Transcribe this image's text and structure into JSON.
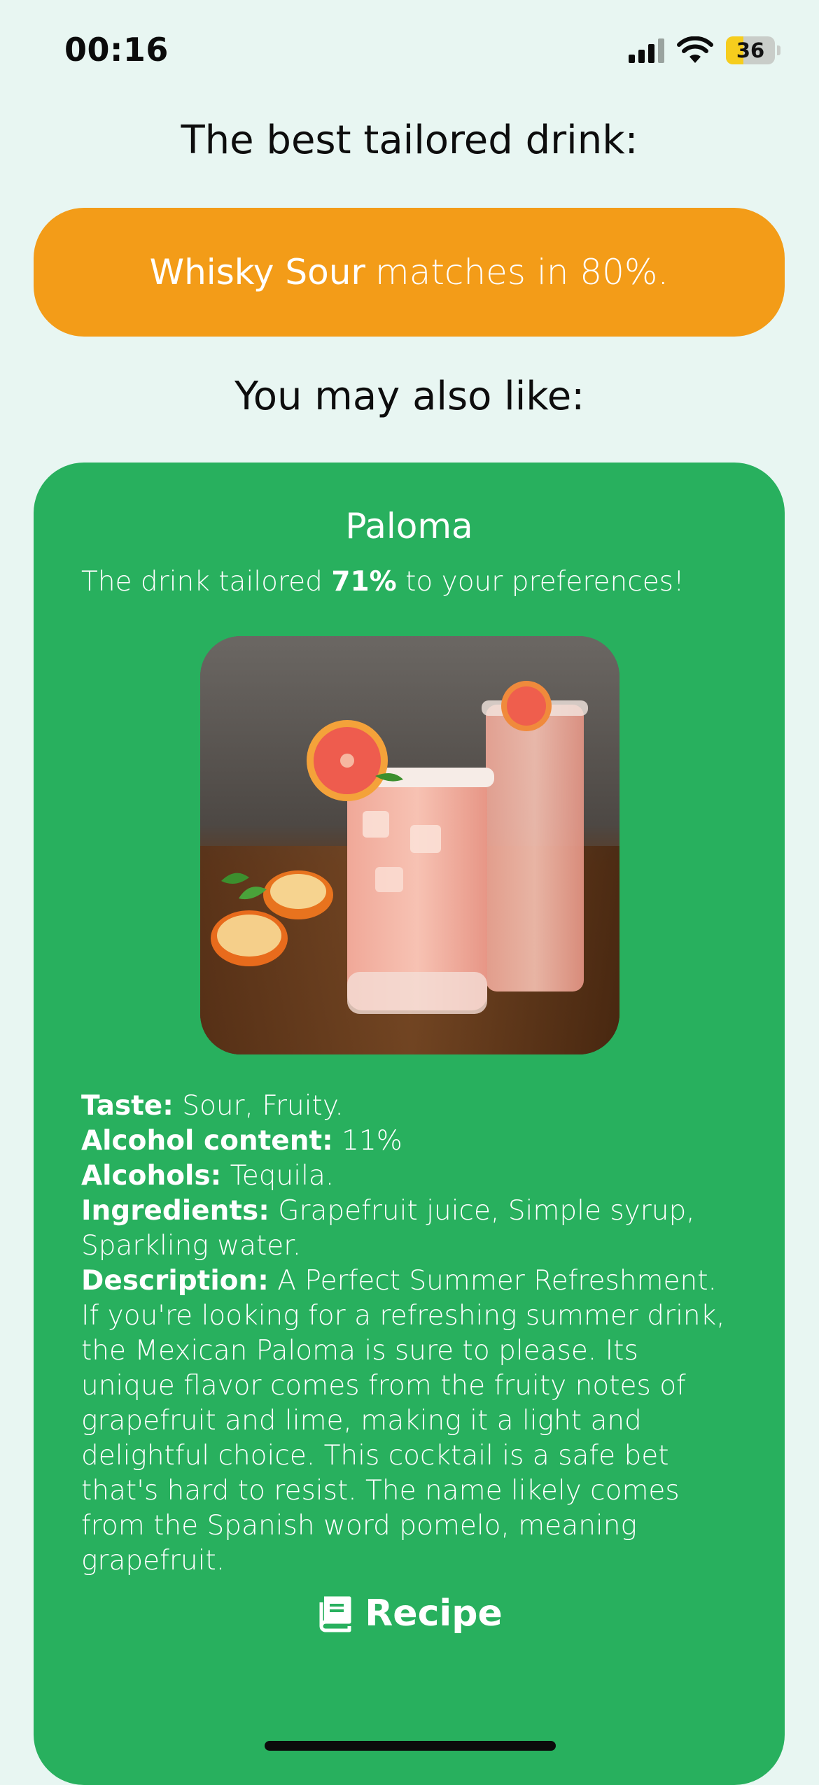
{
  "status_bar": {
    "time": "00:16",
    "battery_level": "36",
    "battery_fraction": 0.36
  },
  "best": {
    "heading": "The best tailored drink:",
    "drink_name": "Whisky Sour",
    "match_text": "matches in 80%.",
    "match_percent": 80,
    "banner_color": "#f39c18"
  },
  "also": {
    "heading": "You may also like:"
  },
  "card": {
    "color": "#28b05e",
    "title": "Paloma",
    "subtitle_pre": "The drink tailored ",
    "subtitle_percent": "71%",
    "subtitle_post": " to your preferences!",
    "image_icon": "cocktail-photo",
    "taste_label": "Taste:",
    "taste_value": "Sour, Fruity.",
    "alcohol_content_label": "Alcohol content:",
    "alcohol_content_value": "11%",
    "alcohols_label": "Alcohols:",
    "alcohols_value": "Tequila.",
    "ingredients_label": "Ingredients:",
    "ingredients_value": "Grapefruit juice, Simple syrup, Sparkling water.",
    "description_label": "Description:",
    "description_value": "A Perfect Summer Refreshment. If you're looking for a refreshing summer drink, the Mexican Paloma is sure to please. Its unique flavor comes from the fruity notes of grapefruit and lime, making it a light and delightful choice. This cocktail is a safe bet that's hard to resist. The name likely comes from the Spanish word pomelo, meaning grapefruit.",
    "recipe_label": "Recipe",
    "recipe_icon": "book-icon"
  }
}
